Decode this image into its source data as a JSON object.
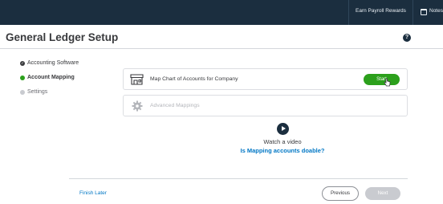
{
  "topbar": {
    "earn_payroll_rewards": "Earn Payroll Rewards",
    "notes": "Notes"
  },
  "header": {
    "title": "General Ledger Setup",
    "help_icon": "help-icon",
    "help_glyph": "?"
  },
  "sidebar": {
    "items": [
      {
        "label": "Accounting Software",
        "state": "completed"
      },
      {
        "label": "Account Mapping",
        "state": "active"
      },
      {
        "label": "Settings",
        "state": "pending"
      }
    ]
  },
  "main": {
    "cards": [
      {
        "label": "Map Chart of Accounts for Company",
        "icon": "storefront-icon",
        "button": "Start",
        "enabled": true
      },
      {
        "label": "Advanced Mappings",
        "icon": "gear-icon",
        "enabled": false
      }
    ],
    "video": {
      "icon": "play-icon",
      "caption": "Watch a video",
      "link": "Is Mapping accounts doable?"
    }
  },
  "footer": {
    "finish_later": "Finish Later",
    "previous": "Previous",
    "next": "Next"
  },
  "colors": {
    "topbar": "#1b2e3f",
    "accent_green": "#2ca01c",
    "link_blue": "#0077c5",
    "disabled_gray": "#c9cbd0"
  }
}
